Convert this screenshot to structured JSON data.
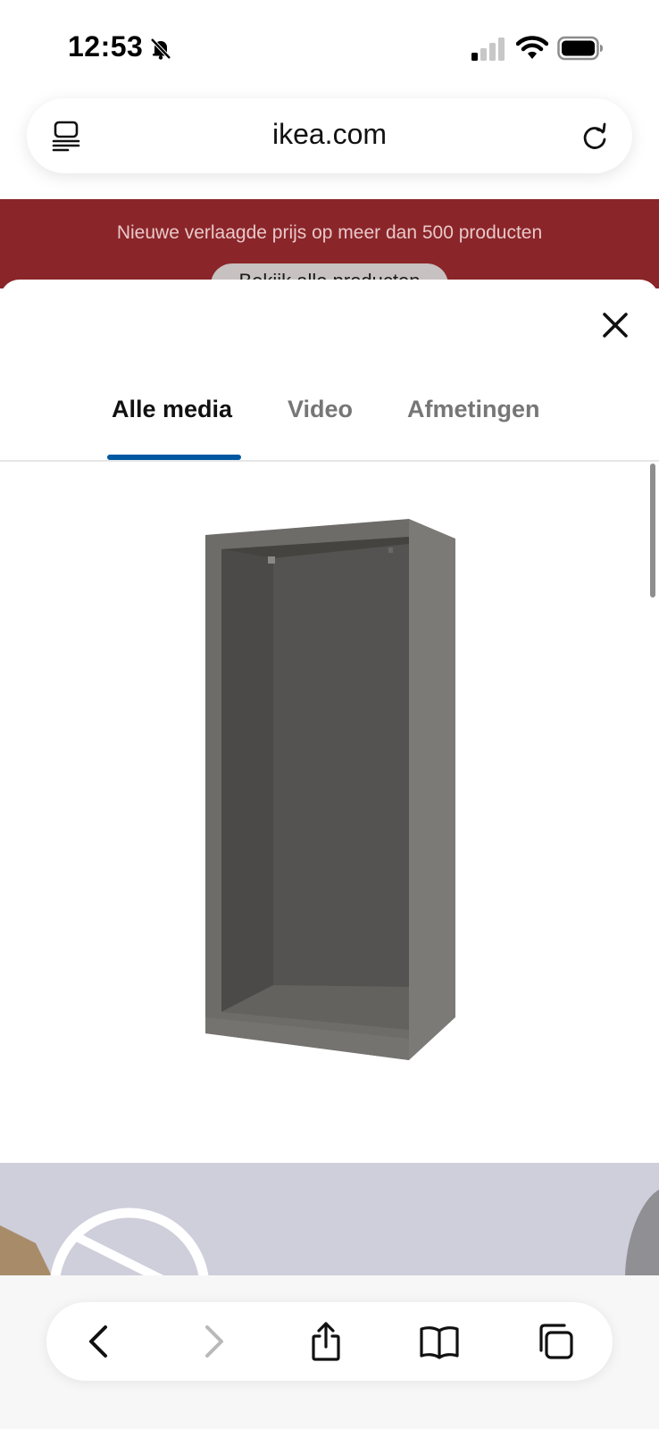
{
  "status_bar": {
    "time": "12:53"
  },
  "browser": {
    "url": "ikea.com"
  },
  "promo": {
    "text": "Nieuwe verlaagde prijs op meer dan 500 producten",
    "button_label": "Bekijk alle producten",
    "background": "#8a2529"
  },
  "media_modal": {
    "tabs": [
      {
        "label": "Alle media",
        "active": true
      },
      {
        "label": "Video",
        "active": false
      },
      {
        "label": "Afmetingen",
        "active": false
      }
    ],
    "active_tab_color": "#0058a3"
  },
  "icons": {
    "status": [
      "bell-slash-icon",
      "cellular-signal-icon",
      "wifi-icon",
      "battery-icon"
    ],
    "browser": [
      "reader-mode-icon",
      "reload-icon"
    ],
    "modal": [
      "close-icon"
    ],
    "toolbar": [
      "back-arrow-icon",
      "forward-arrow-icon",
      "share-icon",
      "bookmarks-icon",
      "tabs-icon"
    ]
  }
}
